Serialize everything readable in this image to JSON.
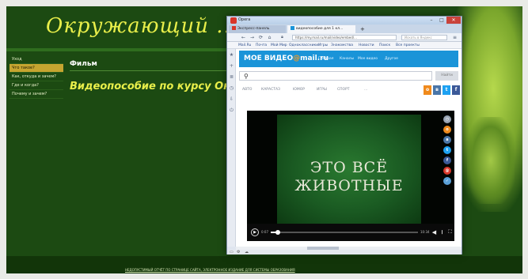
{
  "site": {
    "title": "Окружающий ...",
    "sidebar": [
      {
        "label": "Уход",
        "active": false
      },
      {
        "label": "Что такое?",
        "active": true
      },
      {
        "label": "Как, откуда и зачем?",
        "active": false
      },
      {
        "label": "Где и когда?",
        "active": false
      },
      {
        "label": "Почему и зачем?",
        "active": false
      }
    ],
    "content_title": "Фильм",
    "content_heading": "Видеопособие по курсу Ок",
    "footer_text": "НЕДОПУСТИМЫЙ ОТЧЁТ ПО СТРАНИЦЕ САЙТА, ЭЛЕКТРОННОЕ ИЗДАНИЕ ДЛЯ СИСТЕМЫ ОБРАЗОВАНИЯ"
  },
  "browser": {
    "app_name": "Opera",
    "controls": {
      "minimize": "–",
      "maximize": "□",
      "close": "✕"
    },
    "tabs": [
      {
        "label": "Экспресс-панель"
      },
      {
        "label": "видеопособие для 1 кл..."
      }
    ],
    "tab_add": "+",
    "nav": {
      "back": "←",
      "forward": "→",
      "reload": "⟳",
      "home": "⌂"
    },
    "url": "https://my.mail.ru/mail/video/embed/...",
    "search_placeholder": "Искать в Яндекс",
    "bookmarks": [
      "Mail.Ru",
      "Почта",
      "Мой Мир",
      "Одноклассники",
      "Игры",
      "Знакомства",
      "Новости",
      "Поиск",
      "Все проекты"
    ],
    "side_icons": [
      "star-icon",
      "plus-icon",
      "history-icon",
      "clock-icon",
      "download-icon",
      "power-icon"
    ]
  },
  "video_page": {
    "logo": {
      "prefix": "МОЕ ВИДЕО",
      "at": "@",
      "suffix": "mail.ru"
    },
    "nav": [
      "Главная",
      "Каналы",
      "Мое видео",
      "Другое"
    ],
    "search_query": "",
    "search_button": "Найти",
    "categories": [
      "АВТО",
      "КАРАСТАЗ",
      "ЮМОР",
      "ИГРЫ",
      "СПОРТ",
      "..."
    ],
    "social": {
      "ok": "о",
      "vk": "в",
      "twitter": "t",
      "facebook": "f"
    },
    "video_caption_line1": "ЭТО ВСЁ",
    "video_caption_line2": "ЖИВОТНЫЕ",
    "time_current": "0:07",
    "time_total": "10:34",
    "progress": 0.05,
    "share_colors": [
      "#9aa5b4",
      "#f08a1c",
      "#4a76a8",
      "#1da1f2",
      "#3b5998",
      "#d9372a",
      "#5aa0d8"
    ]
  }
}
